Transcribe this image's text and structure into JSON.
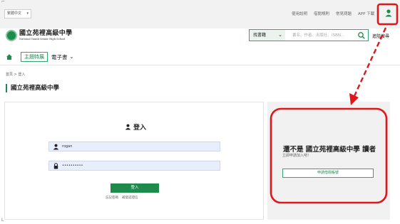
{
  "topbar": {
    "language": "繁體中文",
    "links": [
      "使用說明",
      "借閱規則",
      "常見問題",
      "APP 下載"
    ]
  },
  "header": {
    "logo_cn": "國立苑裡高級中學",
    "logo_en": "National Yuanli Senior High School",
    "search_type": "找書籍",
    "search_placeholder": "書名、作者、出版社、ISBN...",
    "advanced_search": "進階搜尋"
  },
  "nav": {
    "tab_active": "主題特展",
    "tab_ebooks": "電子書"
  },
  "breadcrumb": [
    "首頁",
    "登入"
  ],
  "page_title": "國立苑裡高級中學",
  "login": {
    "title": "登入",
    "username": "rogan",
    "password": "••••••••••",
    "submit": "登入",
    "forgot": "忘記密碼",
    "resend": "補發認證信"
  },
  "side": {
    "title": "還不是 國立苑裡高級中學 讀者",
    "subtitle": "立即申請加入吧！",
    "apply": "申請借閱帳號"
  },
  "colors": {
    "brand_green": "#1e8a4c",
    "annotation_red": "#e0161b"
  },
  "icons": {
    "user": "user-icon",
    "home": "home-icon",
    "search": "search-icon",
    "lock": "lock-icon"
  }
}
